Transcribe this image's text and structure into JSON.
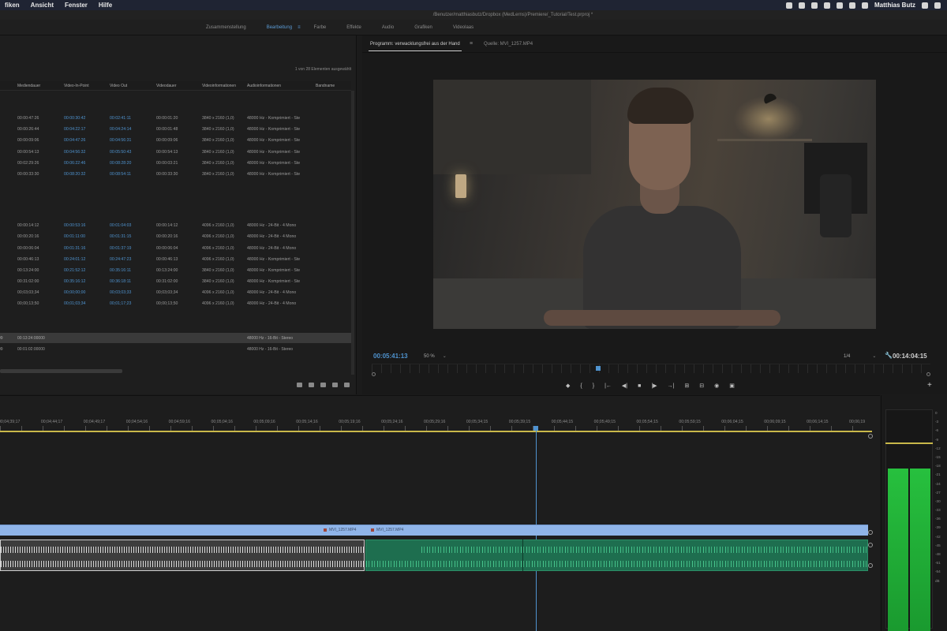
{
  "menubar": {
    "items": [
      "fiken",
      "Ansicht",
      "Fenster",
      "Hilfe"
    ],
    "user": "Matthias Butz"
  },
  "title": "/Benutzer/matthiasbutz/Dropbox (MedLerns)/Premiere/_Tutorial/Test.prproj *",
  "workspaces": [
    "Zusammenstellung",
    "Bearbeitung",
    "Farbe",
    "Effekte",
    "Audio",
    "Grafiken",
    "Videolaas"
  ],
  "workspace_menu_glyph": "≡",
  "project": {
    "count_text": "1 von 28 Elementen ausgewählt",
    "columns": [
      "",
      "Mediendauer",
      "Video-In-Point",
      "Video Out",
      "Videodauer",
      "Videoinformationen",
      "Audioinformationen",
      "Bandname"
    ],
    "group1": [
      [
        "00:00:47:26",
        "00:00:30:42",
        "00:02:41:11",
        "00:00:01:20",
        "3840 x 2160 (1,0)",
        "48000 Hz - Komprimiert - Ste"
      ],
      [
        "00:00:26:44",
        "00:04:22:17",
        "00:04:24:14",
        "00:00:01:48",
        "3840 x 2160 (1,0)",
        "48000 Hz - Komprimiert - Ste"
      ],
      [
        "00:00:09:06",
        "00:04:47:26",
        "00:04:56:31",
        "00:00:09:06",
        "3840 x 2160 (1,0)",
        "48000 Hz - Komprimiert - Ste"
      ],
      [
        "00:00:54:13",
        "00:04:56:32",
        "00:05:50:43",
        "00:00:54:13",
        "3840 x 2160 (1,0)",
        "48000 Hz - Komprimiert - Ste"
      ],
      [
        "00:02:29:26",
        "00:06:22:46",
        "00:08:28:20",
        "00:00:03:21",
        "3840 x 2160 (1,0)",
        "48000 Hz - Komprimiert - Ste"
      ],
      [
        "00:00:33:30",
        "00:08:20:32",
        "00:08:54:11",
        "00:00:33:30",
        "3840 x 2160 (1,0)",
        "48000 Hz - Komprimiert - Ste"
      ]
    ],
    "group2": [
      [
        "00:00:14:12",
        "00:00:53:16",
        "00:01:04:03",
        "00:00:14:12",
        "4096 x 2160 (1,0)",
        "48000 Hz - 24-Bit - 4 Mono"
      ],
      [
        "00:00:20:16",
        "00:01:11:00",
        "00:01:31:15",
        "00:00:20:16",
        "4096 x 2160 (1,0)",
        "48000 Hz - 24-Bit - 4 Mono"
      ],
      [
        "00:00:06:04",
        "00:01:31:16",
        "00:01:37:19",
        "00:00:06:04",
        "4096 x 2160 (1,0)",
        "48000 Hz - 24-Bit - 4 Mono"
      ],
      [
        "00:00:46:13",
        "00:24:01:12",
        "00:24:47:23",
        "00:00:46:13",
        "4096 x 2160 (1,0)",
        "48000 Hz - Komprimiert - Ste"
      ],
      [
        "00:13:24:00",
        "00:21:52:12",
        "00:35:16:11",
        "00:13:24:00",
        "3840 x 2160 (1,0)",
        "48000 Hz - Komprimiert - Ste"
      ],
      [
        "00:31:02:00",
        "00:35:16:12",
        "00:36:18:11",
        "00:31:02:00",
        "3840 x 2160 (1,0)",
        "48000 Hz - Komprimiert - Ste"
      ],
      [
        "00;03;03;34",
        "00;00;00;00",
        "00;03;03;33",
        "00;03;03;34",
        "4096 x 2160 (1,0)",
        "48000 Hz - 24-Bit - 4 Mono"
      ],
      [
        "00;00;13;50",
        "00;01;03;34",
        "00;01;17;23",
        "00;00;13;50",
        "4096 x 2160 (1,0)",
        "48000 Hz - 24-Bit - 4 Mono"
      ]
    ],
    "selected_row": {
      "id": "99",
      "duration": "00:13:24:00000",
      "audio": "48000 Hz - 16-Bit - Stereo"
    },
    "plain_row": {
      "id": "99",
      "duration": "00:01:02:00000",
      "audio": "48000 Hz - 16-Bit - Stereo"
    }
  },
  "monitor": {
    "tab_program": "Programm: verwacklungsfrei aus der Hand",
    "tab_menu": "≡",
    "tab_source": "Quelle: MVI_1257.MP4",
    "timecode": "00:05:41:13",
    "zoom": "50 %",
    "resolution": "1/4",
    "duration": "00:14:04:15",
    "transport": [
      "◆",
      "{",
      "}",
      "|←",
      "◀|",
      "■",
      "|▶",
      "→|",
      "⊞",
      "⊟",
      "◉",
      "▣"
    ],
    "add": "+"
  },
  "timeline": {
    "ticks": [
      "00;04;39;17",
      "00;04;44;17",
      "00;04;49;17",
      "00;04;54;16",
      "00;04;59;16",
      "00;05;04;16",
      "00;05;09;16",
      "00;05;14;16",
      "00;05;19;16",
      "00;05;24;16",
      "00;05;29;16",
      "00;05;34;15",
      "00;05;39;15",
      "00;05;44;15",
      "00;05;49;15",
      "00;05;54;15",
      "00;05;59;15",
      "00;06;04;15",
      "00;06;09;15",
      "00;06;14;15",
      "00;06;19"
    ],
    "clip_a": "MVI_1257.MP4",
    "clip_b": "MVI_1257.MP4"
  },
  "meter": {
    "scale": [
      "0",
      "-3",
      "-6",
      "-9",
      "-12",
      "-15",
      "-18",
      "-21",
      "-24",
      "-27",
      "-30",
      "-33",
      "-36",
      "-39",
      "-42",
      "-45",
      "-48",
      "-51",
      "-54",
      "dB"
    ]
  }
}
